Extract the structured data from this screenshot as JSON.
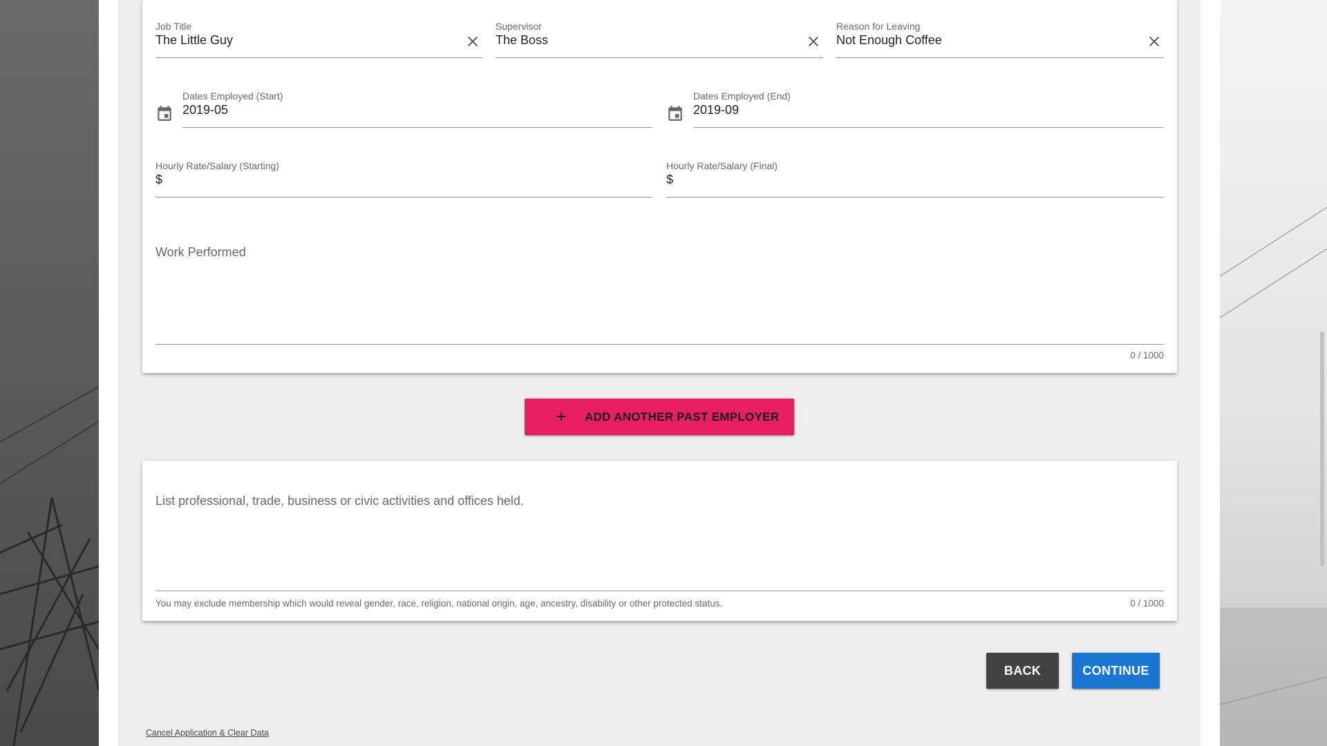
{
  "employer": {
    "job_title": {
      "label": "Job Title",
      "value": "The Little Guy"
    },
    "supervisor": {
      "label": "Supervisor",
      "value": "The Boss"
    },
    "reason": {
      "label": "Reason for Leaving",
      "value": "Not Enough Coffee"
    },
    "date_start": {
      "label": "Dates Employed (Start)",
      "value": "2019-05"
    },
    "date_end": {
      "label": "Dates Employed (End)",
      "value": "2019-09"
    },
    "rate_start": {
      "label": "Hourly Rate/Salary (Starting)",
      "prefix": "$"
    },
    "rate_final": {
      "label": "Hourly Rate/Salary (Final)",
      "prefix": "$"
    },
    "work_performed": {
      "label": "Work Performed",
      "counter": "0 / 1000"
    }
  },
  "add_button_label": "ADD ANOTHER PAST EMPLOYER",
  "activities": {
    "label": "List professional, trade, business or civic activities and offices held.",
    "hint": "You may exclude membership which would reveal gender, race, religion, national origin, age, ancestry, disability or other protected status.",
    "counter": "0 / 1000"
  },
  "back_label": "BACK",
  "continue_label": "CONTINUE",
  "cancel_link": "Cancel Application & Clear Data",
  "icons": {
    "clear": "close-icon",
    "calendar": "calendar-icon",
    "add": "plus-icon"
  },
  "colors": {
    "add_button": "#e91e63",
    "back_button": "#424242",
    "continue_button": "#1976d2"
  }
}
